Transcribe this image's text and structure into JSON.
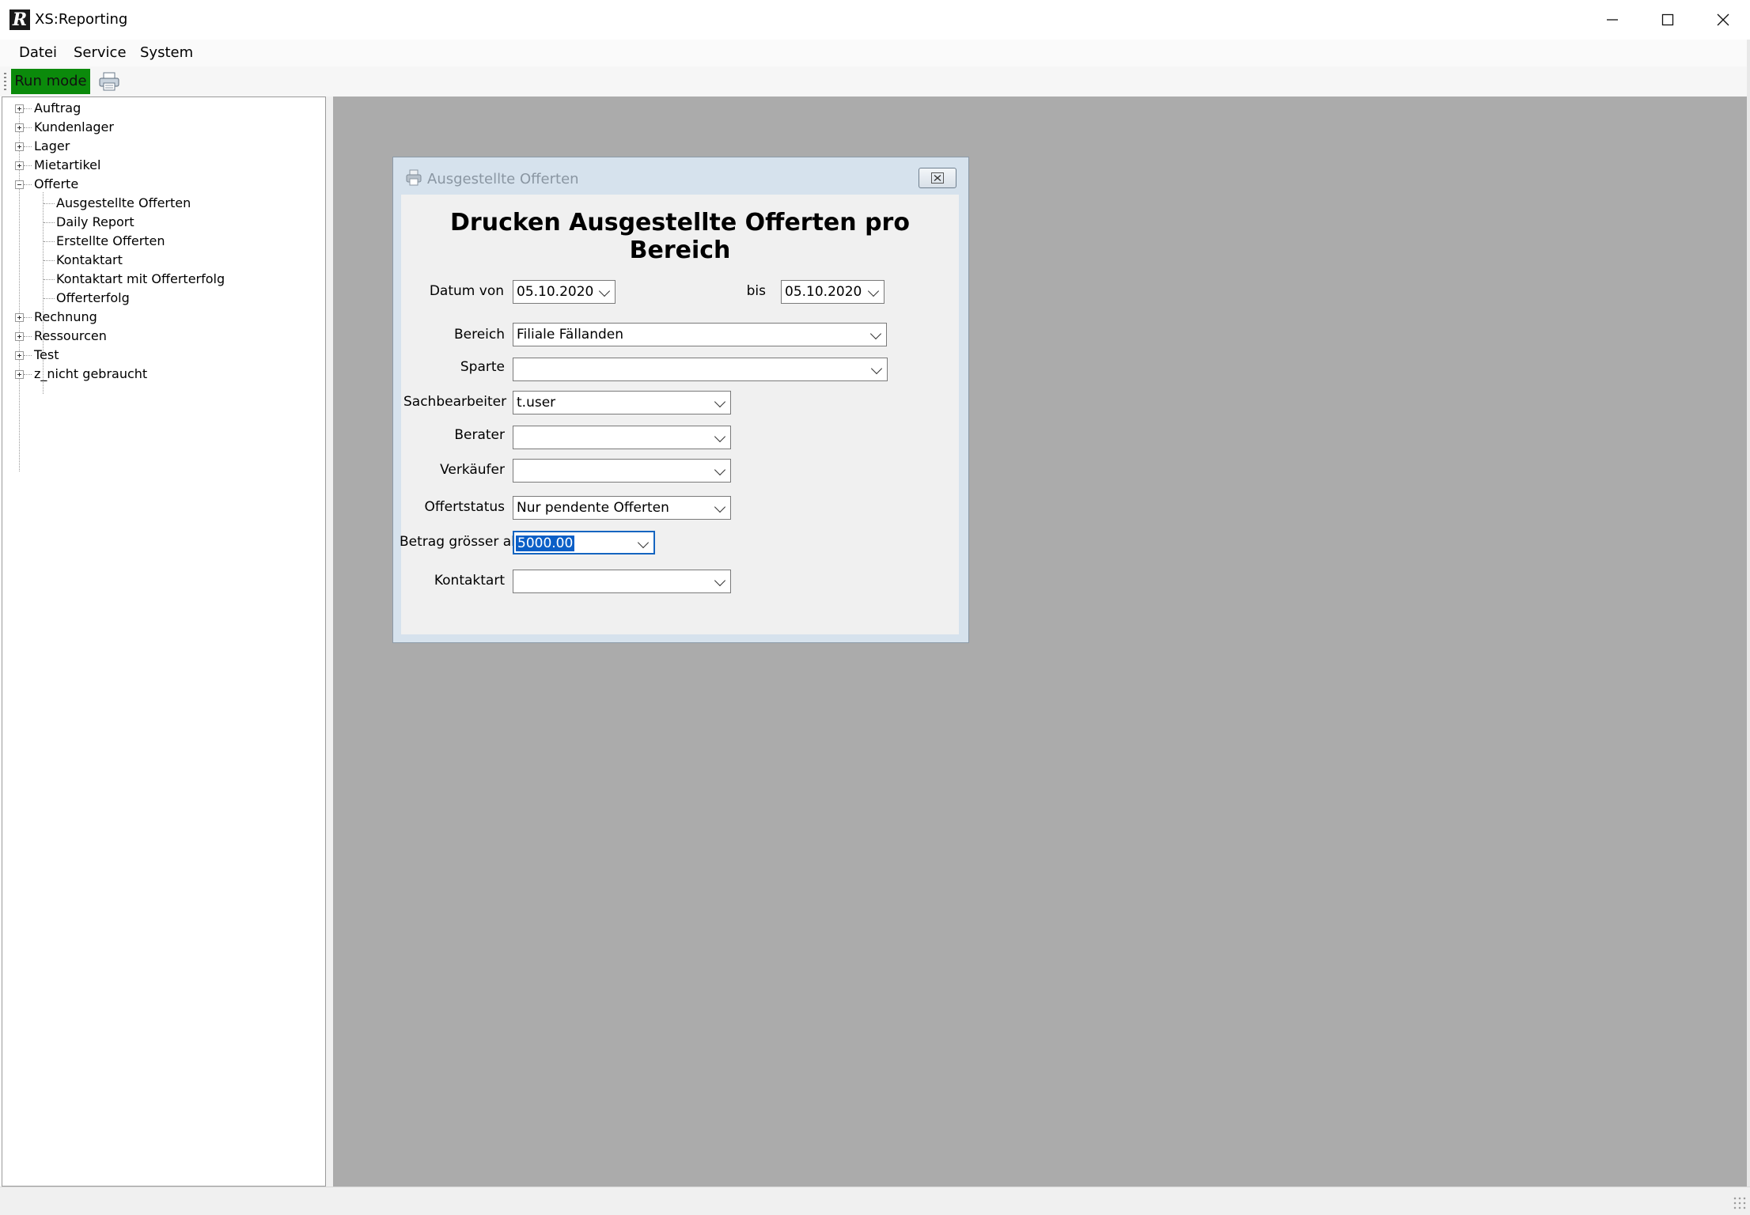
{
  "window": {
    "title": "XS:Reporting",
    "minimize_icon": "minimize-icon",
    "maximize_icon": "maximize-icon",
    "close_icon": "close-icon"
  },
  "menu": {
    "items": [
      "Datei",
      "Service",
      "System"
    ]
  },
  "toolbar": {
    "run_mode_label": "Run mode",
    "run_mode_color": "#0b8a0b",
    "print_icon": "printer-icon"
  },
  "tree": {
    "nodes": [
      {
        "label": "Auftrag",
        "expanded": false
      },
      {
        "label": "Kundenlager",
        "expanded": false
      },
      {
        "label": "Lager",
        "expanded": false
      },
      {
        "label": "Mietartikel",
        "expanded": false
      },
      {
        "label": "Offerte",
        "expanded": true,
        "children": [
          "Ausgestellte Offerten",
          "Daily Report",
          "Erstellte Offerten",
          "Kontaktart",
          "Kontaktart mit Offerterfolg",
          "Offerterfolg"
        ]
      },
      {
        "label": "Rechnung",
        "expanded": false
      },
      {
        "label": "Ressourcen",
        "expanded": false
      },
      {
        "label": "Test",
        "expanded": false
      },
      {
        "label": "z_nicht gebraucht",
        "expanded": false
      }
    ]
  },
  "dialog": {
    "title": "Ausgestellte Offerten",
    "heading": "Drucken Ausgestellte Offerten pro Bereich",
    "fields": {
      "datum_von": {
        "label": "Datum von",
        "value": "05.10.2020"
      },
      "bis": {
        "label": "bis",
        "value": "05.10.2020"
      },
      "bereich": {
        "label": "Bereich",
        "value": "Filiale Fällanden"
      },
      "sparte": {
        "label": "Sparte",
        "value": ""
      },
      "sachbearbeiter": {
        "label": "Sachbearbeiter",
        "value": "t.user"
      },
      "berater": {
        "label": "Berater",
        "value": ""
      },
      "verkaeufer": {
        "label": "Verkäufer",
        "value": ""
      },
      "offertstatus": {
        "label": "Offertstatus",
        "value": "Nur pendente Offerten"
      },
      "betrag": {
        "label": "Betrag grösser als",
        "value": "5000.00"
      },
      "kontaktart": {
        "label": "Kontaktart",
        "value": ""
      }
    }
  },
  "colors": {
    "mdi_background": "#ababab",
    "focus_border": "#1565c0",
    "selection": "#0b5fc7"
  }
}
